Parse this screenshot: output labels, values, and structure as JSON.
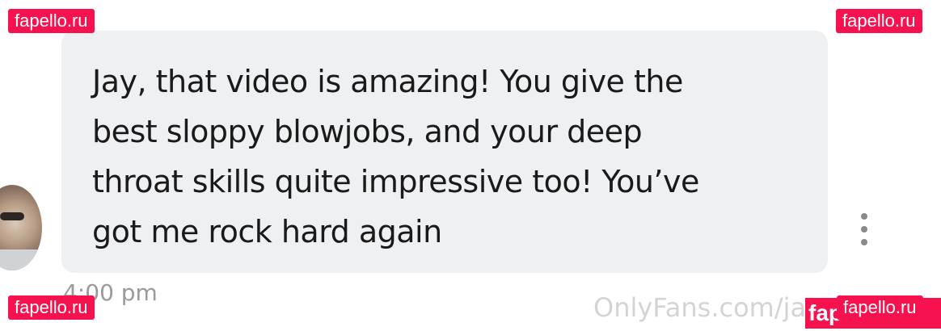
{
  "message": {
    "lines": [
      "Jay, that video is amazing! You give the",
      "best sloppy blowjobs, and your deep",
      "throat skills quite impressive too! You’ve",
      "got me rock hard again"
    ],
    "timestamp": "4:00 pm"
  },
  "watermarks": {
    "site": "fapello.ru",
    "partial": "fap",
    "source": "OnlyFans.com/ja"
  },
  "icons": {
    "more": "more-vertical-icon",
    "avatar": "user-avatar"
  },
  "colors": {
    "bubble_bg": "#eef0f2",
    "text": "#1a1a1a",
    "timestamp": "#9a9a9a",
    "watermark_bg": "#f5124e"
  }
}
